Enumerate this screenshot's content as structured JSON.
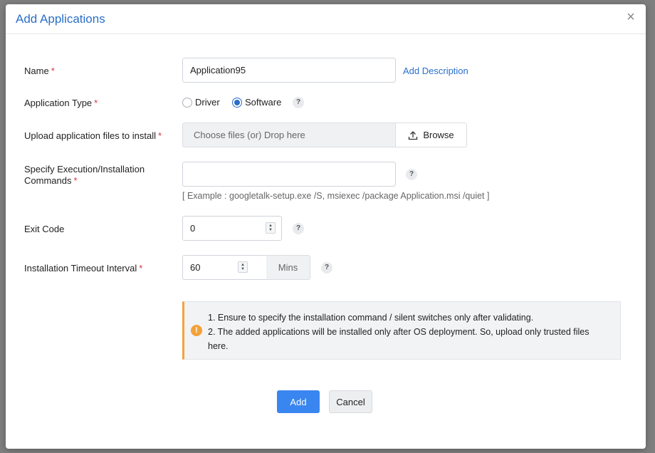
{
  "dialog": {
    "title": "Add Applications",
    "close_label": "×"
  },
  "fields": {
    "name": {
      "label": "Name",
      "value": "Application95",
      "add_description": "Add Description"
    },
    "app_type": {
      "label": "Application Type",
      "options": [
        "Driver",
        "Software"
      ],
      "selected": "Software"
    },
    "upload": {
      "label": "Upload application files to install",
      "placeholder": "Choose files (or) Drop here",
      "browse_label": "Browse"
    },
    "commands": {
      "label_line1": "Specify Execution/Installation",
      "label_line2": "Commands",
      "value": "",
      "example": "[ Example : googletalk-setup.exe /S, msiexec /package Application.msi /quiet ]"
    },
    "exit_code": {
      "label": "Exit Code",
      "value": "0"
    },
    "timeout": {
      "label": "Installation Timeout Interval",
      "value": "60",
      "unit": "Mins"
    }
  },
  "help_glyph": "?",
  "required_marker": "*",
  "note": {
    "line1": "1. Ensure to specify the installation command / silent switches only after validating.",
    "line2": "2. The added applications will be installed only after OS deployment. So, upload only trusted files here.",
    "icon_glyph": "!"
  },
  "buttons": {
    "add": "Add",
    "cancel": "Cancel"
  },
  "colors": {
    "accent": "#2a6fc7",
    "primary_button": "#3a86f0",
    "required": "#d9333f",
    "warning": "#f3a23b"
  }
}
